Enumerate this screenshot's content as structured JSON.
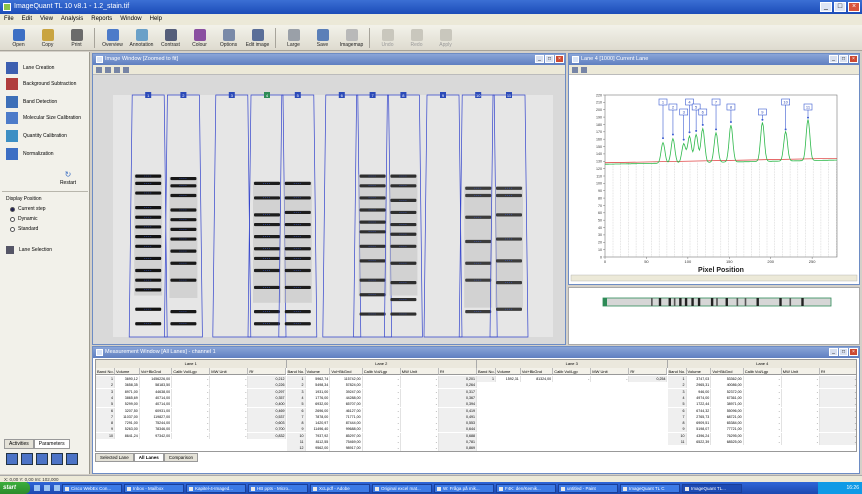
{
  "app": {
    "title": "ImageQuant TL  10 v8.1 - 1.2_stain.tif"
  },
  "menu": [
    "File",
    "Edit",
    "View",
    "Analysis",
    "Reports",
    "Window",
    "Help"
  ],
  "toolbar": [
    {
      "label": "Open",
      "color": "#3d6fc4",
      "enabled": true
    },
    {
      "label": "Copy",
      "color": "#c9a441",
      "enabled": true
    },
    {
      "label": "Print",
      "color": "#6b6b6b",
      "enabled": true
    },
    {
      "label": "Overview",
      "color": "#4d7bc9",
      "enabled": true
    },
    {
      "label": "Annotation",
      "color": "#6aa0c8",
      "enabled": true
    },
    {
      "label": "Contrast",
      "color": "#555e7a",
      "enabled": true
    },
    {
      "label": "Colour",
      "color": "#8a4fa0",
      "enabled": true
    },
    {
      "label": "Options",
      "color": "#7a8aa8",
      "enabled": true
    },
    {
      "label": "Edit image",
      "color": "#5a6e98",
      "enabled": true
    },
    {
      "label": "Large",
      "color": "#9aa0a8",
      "enabled": true
    },
    {
      "label": "Save",
      "color": "#5b7fb8",
      "enabled": true
    },
    {
      "label": "Imagemap",
      "color": "#b9b9b9",
      "enabled": true
    },
    {
      "label": "Undo",
      "color": "#c9c7bd",
      "enabled": false
    },
    {
      "label": "Redo",
      "color": "#c9c7bd",
      "enabled": false
    },
    {
      "label": "Apply",
      "color": "#c9c7bd",
      "enabled": false
    }
  ],
  "left_panel": {
    "tools": [
      {
        "label": "Lane Creation",
        "color": "#3d5fb0"
      },
      {
        "label": "Background Subtraction",
        "color": "#b03d3d"
      },
      {
        "label": "Band Detection",
        "color": "#3d6fb8"
      },
      {
        "label": "Molecular Size Calibration",
        "color": "#4d7bc9"
      },
      {
        "label": "Quantity Calibration",
        "color": "#3d8fc4"
      },
      {
        "label": "Normalization",
        "color": "#3d6fc4"
      }
    ],
    "restart_label": "Restart",
    "display_position": {
      "title": "Display Position",
      "options": [
        "Current step",
        "Dynamic",
        "Standard"
      ],
      "selected": 0
    },
    "lane_selection": "Lane Selection",
    "tabs": [
      "Activities",
      "Parameters"
    ],
    "active_tab": 1
  },
  "image_window": {
    "title": "Image Window [Zoomed to fit]",
    "lanes": [
      {
        "x": 0.08,
        "bands": [
          0.37,
          0.4,
          0.44,
          0.5,
          0.54,
          0.58,
          0.62,
          0.66,
          0.71,
          0.76,
          0.8,
          0.84,
          0.92,
          0.98
        ],
        "strength": 1.0
      },
      {
        "x": 0.16,
        "bands": [
          0.38,
          0.41,
          0.45,
          0.51,
          0.55,
          0.59,
          0.63,
          0.68,
          0.73,
          0.8,
          0.93,
          0.98
        ],
        "strength": 0.95
      },
      {
        "x": 0.27,
        "bands": [],
        "strength": 0.1
      },
      {
        "x": 0.35,
        "bands": [
          0.4,
          0.46,
          0.53,
          0.57,
          0.62,
          0.67,
          0.71,
          0.76,
          0.83,
          0.93,
          0.98
        ],
        "strength": 0.9
      },
      {
        "x": 0.42,
        "bands": [
          0.4,
          0.46,
          0.52,
          0.57,
          0.62,
          0.67,
          0.71,
          0.76,
          0.83,
          0.93,
          0.98
        ],
        "strength": 0.9
      },
      {
        "x": 0.52,
        "bands": [],
        "strength": 0.1
      },
      {
        "x": 0.59,
        "bands": [
          0.37,
          0.41,
          0.46,
          0.51,
          0.56,
          0.6,
          0.66,
          0.72,
          0.8,
          0.86,
          0.94
        ],
        "strength": 0.7
      },
      {
        "x": 0.66,
        "bands": [
          0.37,
          0.41,
          0.47,
          0.52,
          0.57,
          0.61,
          0.66,
          0.73,
          0.81,
          0.88,
          0.94
        ],
        "strength": 0.7
      },
      {
        "x": 0.75,
        "bands": [],
        "strength": 0.05
      },
      {
        "x": 0.83,
        "bands": [
          0.42,
          0.45,
          0.54,
          0.64,
          0.73,
          0.8,
          0.93
        ],
        "strength": 0.55
      },
      {
        "x": 0.9,
        "bands": [
          0.42,
          0.45,
          0.53,
          0.63,
          0.72,
          0.81,
          0.92
        ],
        "strength": 0.55
      }
    ],
    "lane_labels": [
      "1",
      "2",
      "3",
      "4",
      "5",
      "6",
      "7",
      "8",
      "9",
      "10",
      "11"
    ]
  },
  "profile_window": {
    "title": "Lane 4 [1000] Current Lane",
    "x_axis_label": "Pixel Position",
    "y_ticks": [
      "220",
      "210",
      "200",
      "190",
      "180",
      "170",
      "160",
      "150",
      "140",
      "130",
      "120",
      "110",
      "100",
      "90",
      "80",
      "70",
      "60",
      "50",
      "40",
      "30",
      "20",
      "10",
      "0"
    ],
    "x_ticks": [
      "0",
      "50",
      "100",
      "150",
      "200",
      "250"
    ],
    "peak_labels": [
      "1",
      "2",
      "3",
      "4",
      "5",
      "6",
      "7",
      "8",
      "9",
      "10",
      "11"
    ],
    "peak_positions": [
      70,
      82,
      95,
      102,
      110,
      118,
      134,
      152,
      190,
      218,
      245
    ],
    "peak_heights": [
      160,
      165,
      158,
      168,
      170,
      178,
      172,
      182,
      185,
      172,
      188
    ]
  },
  "measurement_window": {
    "title": "Measurement Window [All Lanes] - channel 1",
    "groups": [
      "Lane 1",
      "Lane 2",
      "Lane 3",
      "Lane 4"
    ],
    "columns": [
      "Band No.",
      "Volume",
      "Vol+BkGnd",
      "Calib Vol/Lgp",
      "MW Unit",
      "Rf"
    ],
    "lane1": [
      [
        "1",
        "3690,12",
        "1456226,00",
        "-",
        "-",
        "0,212"
      ],
      [
        "2",
        "3658,35",
        "58183,50",
        "-",
        "-",
        "0,226"
      ],
      [
        "3",
        "8971,00",
        "44638,00",
        "-",
        "-",
        "0,297"
      ],
      [
        "4",
        "3865,69",
        "40714,00",
        "-",
        "-",
        "0,357"
      ],
      [
        "5",
        "5299,00",
        "40714,00",
        "-",
        "-",
        "0,400"
      ],
      [
        "6",
        "3207,50",
        "60931,00",
        "-",
        "-",
        "0,469"
      ],
      [
        "7",
        "11037,00",
        "119827,00",
        "-",
        "-",
        "0,537"
      ],
      [
        "8",
        "7291,00",
        "75244,00",
        "-",
        "-",
        "0,603"
      ],
      [
        "9",
        "5263,00",
        "78346,00",
        "-",
        "-",
        "0,700"
      ],
      [
        "10",
        "8641,24",
        "97342,00",
        "-",
        "-",
        "0,832"
      ]
    ],
    "lane2": [
      [
        "1",
        "5962,74",
        "115742,00",
        "-",
        "-",
        "0,201"
      ],
      [
        "2",
        "5498,34",
        "57824,00",
        "-",
        "-",
        "0,264"
      ],
      [
        "3",
        "1931,00",
        "39247,00",
        "-",
        "-",
        "0,317"
      ],
      [
        "4",
        "1776,00",
        "44288,00",
        "-",
        "-",
        "0,367"
      ],
      [
        "5",
        "6932,00",
        "65707,00",
        "-",
        "-",
        "0,394"
      ],
      [
        "6",
        "2696,00",
        "46127,00",
        "-",
        "-",
        "0,419"
      ],
      [
        "7",
        "7878,00",
        "71771,00",
        "-",
        "-",
        "0,491"
      ],
      [
        "8",
        "1420,97",
        "87444,00",
        "-",
        "-",
        "0,553"
      ],
      [
        "9",
        "11496,40",
        "99688,00",
        "-",
        "-",
        "0,644"
      ],
      [
        "10",
        "7937,92",
        "85297,00",
        "-",
        "-",
        "0,688"
      ],
      [
        "11",
        "8112,55",
        "75469,00",
        "-",
        "-",
        "0,781"
      ],
      [
        "12",
        "9562,00",
        "98917,00",
        "-",
        "-",
        "0,869"
      ]
    ],
    "lane3": [
      [
        "1",
        "1592,31",
        "81324,00",
        "-",
        "-",
        "0,254"
      ]
    ],
    "lane4": [
      [
        "1",
        "3747,03",
        "53362,00",
        "-",
        "-",
        "-"
      ],
      [
        "2",
        "2965,31",
        "40086,00",
        "-",
        "-",
        "-"
      ],
      [
        "3",
        "946,00",
        "52372,00",
        "-",
        "-",
        "-"
      ],
      [
        "4",
        "4974,00",
        "67361,00",
        "-",
        "-",
        "-"
      ],
      [
        "5",
        "1722,44",
        "38971,00",
        "-",
        "-",
        "-"
      ],
      [
        "6",
        "6744,32",
        "55096,00",
        "-",
        "-",
        "-"
      ],
      [
        "7",
        "2765,73",
        "68721,00",
        "-",
        "-",
        "-"
      ],
      [
        "8",
        "6909,51",
        "65384,00",
        "-",
        "-",
        "-"
      ],
      [
        "9",
        "5198,07",
        "77721,00",
        "-",
        "-",
        "-"
      ],
      [
        "10",
        "4396,24",
        "76295,00",
        "-",
        "-",
        "-"
      ],
      [
        "11",
        "6522,39",
        "68525,00",
        "-",
        "-",
        "-"
      ]
    ],
    "tabs": [
      "Selected Lane",
      "All Lanes",
      "Comparison"
    ],
    "active_tab": 1
  },
  "status": "X: 0,00  Y: 0,00  Int: 102,000",
  "taskbar": {
    "start": "start",
    "tasks": [
      "Cisco WebEx Con...",
      "Inbox - Mailbox",
      "Kapitel-4-Imaged...",
      "HB ppts - Micro...",
      "XcLpdf - Adobe",
      "Original excel mat...",
      "W: Fråga på mik...",
      "F4K: den/Kemik...",
      "untitled - Paint",
      "ImageQuant TL C",
      "ImageQuant TL..."
    ],
    "active_index": 10,
    "clock": "16:26"
  }
}
